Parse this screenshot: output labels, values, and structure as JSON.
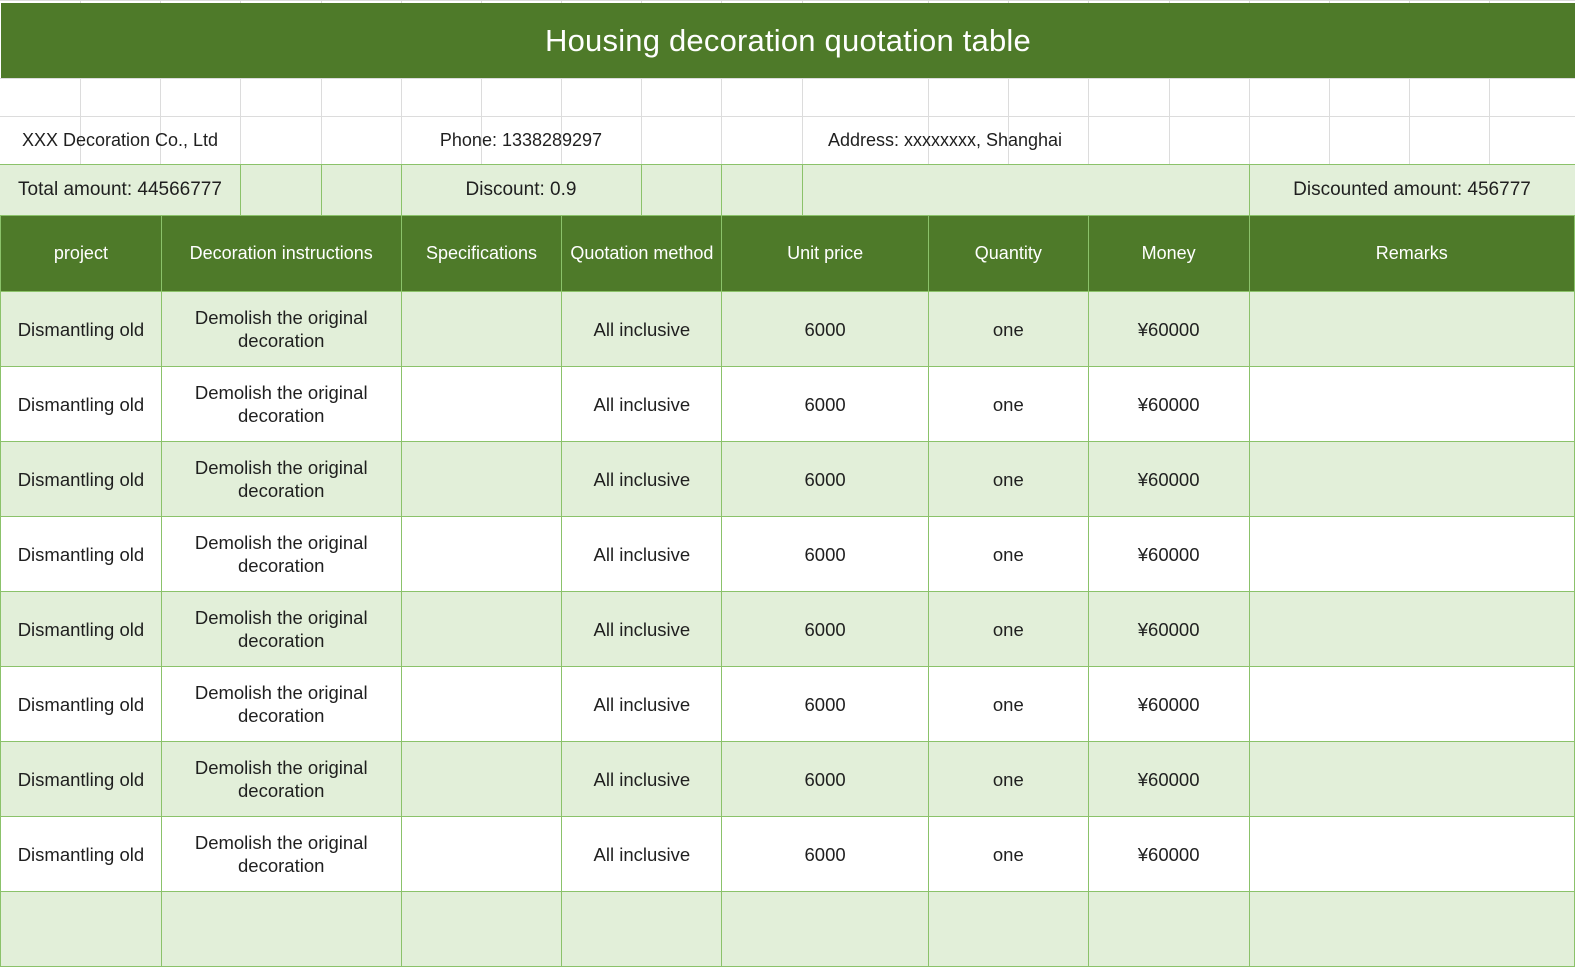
{
  "sheet": {
    "title": "Housing decoration quotation table",
    "company": "XXX Decoration Co., Ltd",
    "phone": "Phone: 1338289297",
    "address": "Address: xxxxxxxx, Shanghai",
    "total_amount": "Total amount: 44566777",
    "discount": "Discount: 0.9",
    "discounted_amount": "Discounted amount: 456777"
  },
  "table": {
    "headers": [
      "project",
      "Decoration instructions",
      "Specifications",
      "Quotation method",
      "Unit price",
      "Quantity",
      "Money",
      "Remarks"
    ],
    "rows": [
      [
        "Dismantling old",
        "Demolish the original decoration",
        "",
        "All inclusive",
        "6000",
        "one",
        "¥60000",
        ""
      ],
      [
        "Dismantling old",
        "Demolish the original decoration",
        "",
        "All inclusive",
        "6000",
        "one",
        "¥60000",
        ""
      ],
      [
        "Dismantling old",
        "Demolish the original decoration",
        "",
        "All inclusive",
        "6000",
        "one",
        "¥60000",
        ""
      ],
      [
        "Dismantling old",
        "Demolish the original decoration",
        "",
        "All inclusive",
        "6000",
        "one",
        "¥60000",
        ""
      ],
      [
        "Dismantling old",
        "Demolish the original decoration",
        "",
        "All inclusive",
        "6000",
        "one",
        "¥60000",
        ""
      ],
      [
        "Dismantling old",
        "Demolish the original decoration",
        "",
        "All inclusive",
        "6000",
        "one",
        "¥60000",
        ""
      ],
      [
        "Dismantling old",
        "Demolish the original decoration",
        "",
        "All inclusive",
        "6000",
        "one",
        "¥60000",
        ""
      ],
      [
        "Dismantling old",
        "Demolish the original decoration",
        "",
        "All inclusive",
        "6000",
        "one",
        "¥60000",
        ""
      ],
      [
        "",
        "",
        "",
        "",
        "",
        "",
        "",
        ""
      ]
    ]
  },
  "colors": {
    "header_green": "#4e7a29",
    "band_light_green": "#e2efd9",
    "border_green": "#8bc26a"
  }
}
